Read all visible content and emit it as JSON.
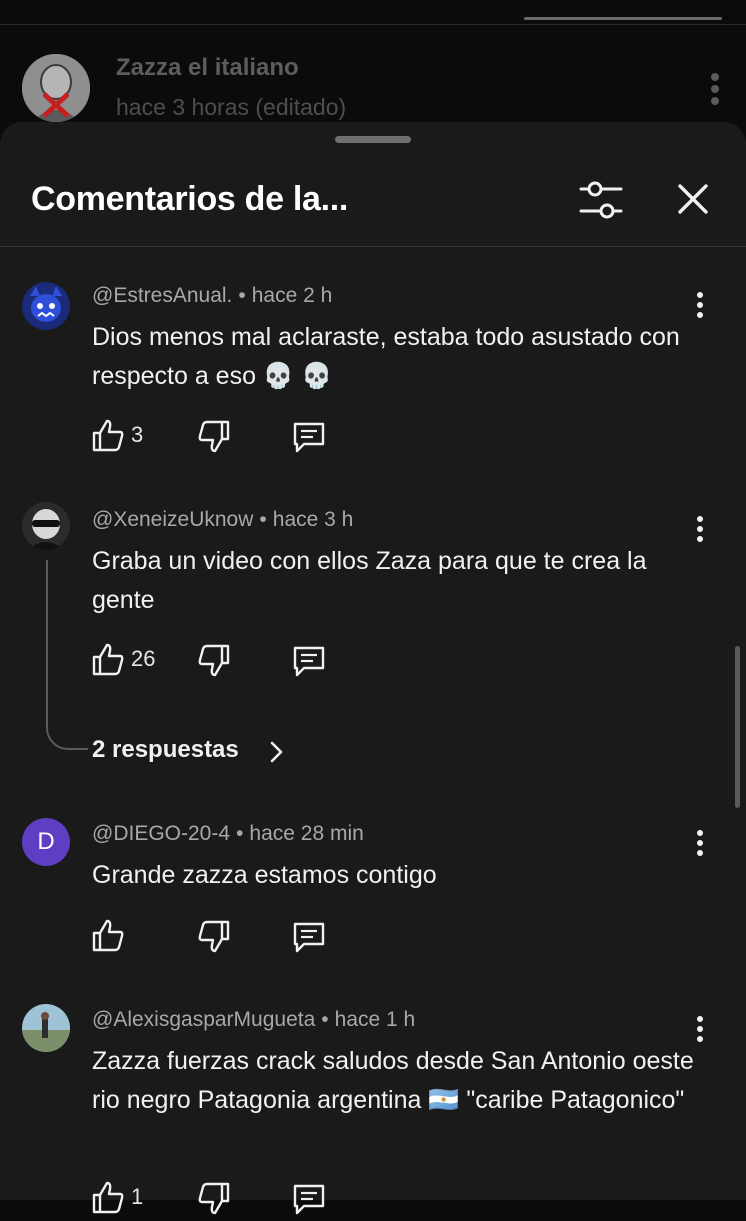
{
  "background_comment": {
    "author": "Zazza el italiano",
    "time": "hace 3 horas (editado)"
  },
  "sheet": {
    "title": "Comentarios de la...",
    "filter_icon": "sliders-icon",
    "close_icon": "close-icon"
  },
  "comments": [
    {
      "author": "@EstresAnual.",
      "time": "hace 2 h",
      "text": "Dios menos mal aclaraste, estaba todo asustado con respecto a eso 💀 💀",
      "likes": "3"
    },
    {
      "author": "@XeneizeUknow",
      "time": "hace 3 h",
      "text": "Graba un video con ellos Zaza para que te crea la gente",
      "likes": "26",
      "replies_label": "2 respuestas"
    },
    {
      "author": "@DIEGO-20-4",
      "avatar_letter": "D",
      "time": "hace 28 min",
      "text": "Grande zazza estamos contigo",
      "likes": ""
    },
    {
      "author": "@AlexisgasparMugueta",
      "time": "hace 1 h",
      "text": "Zazza fuerzas crack saludos desde San Antonio oeste rio negro Patagonia argentina 🇦🇷  \"caribe Patagonico\"",
      "likes": "1"
    }
  ],
  "separator": "•",
  "colors": {
    "sheet_bg": "#1a1a1a",
    "page_bg": "#0b0b0b",
    "text": "#f1f1f1",
    "meta": "#a8a8a8",
    "avatar_d": "#5e3fc4"
  }
}
